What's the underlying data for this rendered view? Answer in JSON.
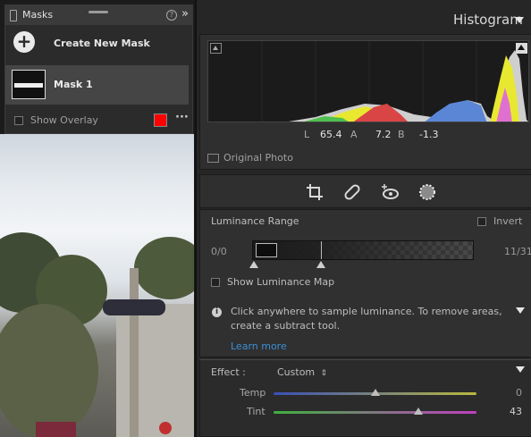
{
  "masks_panel": {
    "title": "Masks",
    "create_new_label": "Create New Mask",
    "mask_item_label": "Mask 1",
    "show_overlay_label": "Show Overlay",
    "overlay_color": "#ff0000"
  },
  "histogram": {
    "title": "Histogram",
    "L_label": "L",
    "L_value": "65.4",
    "A_label": "A",
    "A_value": "7.2",
    "B_label": "B",
    "B_value": "-1.3",
    "original_photo_label": "Original Photo"
  },
  "tools": {
    "icons": [
      "crop-icon",
      "healing-icon",
      "red-eye-icon",
      "masking-icon"
    ]
  },
  "luminance": {
    "title": "Luminance Range",
    "invert_label": "Invert",
    "range_left": "0/0",
    "range_right": "11/31",
    "show_map_label": "Show Luminance Map",
    "info_text_line1": "Click anywhere to sample luminance. To remove areas,",
    "info_text_line2": "create a subtract tool.",
    "learn_more_label": "Learn more"
  },
  "effect": {
    "label": "Effect :",
    "preset": "Custom",
    "temp_label": "Temp",
    "temp_value": "0",
    "temp_level": 0.5,
    "tint_label": "Tint",
    "tint_value": "43",
    "tint_level": 0.715
  },
  "colors": {
    "accent": "#3b8fd6",
    "panel": "#303030",
    "background": "#262626"
  }
}
